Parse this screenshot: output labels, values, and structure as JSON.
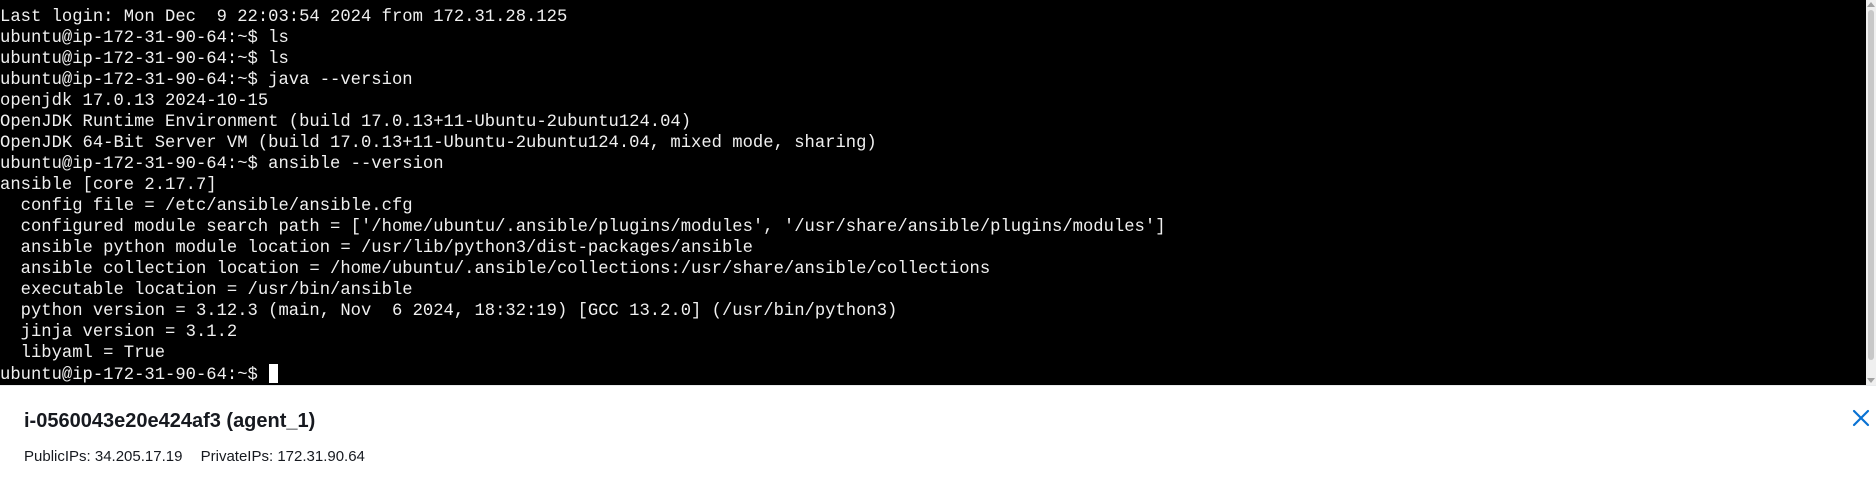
{
  "terminal": {
    "lines": [
      "Last login: Mon Dec  9 22:03:54 2024 from 172.31.28.125",
      "ubuntu@ip-172-31-90-64:~$ ls",
      "ubuntu@ip-172-31-90-64:~$ ls",
      "ubuntu@ip-172-31-90-64:~$ java --version",
      "openjdk 17.0.13 2024-10-15",
      "OpenJDK Runtime Environment (build 17.0.13+11-Ubuntu-2ubuntu124.04)",
      "OpenJDK 64-Bit Server VM (build 17.0.13+11-Ubuntu-2ubuntu124.04, mixed mode, sharing)",
      "ubuntu@ip-172-31-90-64:~$ ansible --version",
      "ansible [core 2.17.7]",
      "  config file = /etc/ansible/ansible.cfg",
      "  configured module search path = ['/home/ubuntu/.ansible/plugins/modules', '/usr/share/ansible/plugins/modules']",
      "  ansible python module location = /usr/lib/python3/dist-packages/ansible",
      "  ansible collection location = /home/ubuntu/.ansible/collections:/usr/share/ansible/collections",
      "  executable location = /usr/bin/ansible",
      "  python version = 3.12.3 (main, Nov  6 2024, 18:32:19) [GCC 13.2.0] (/usr/bin/python3)",
      "  jinja version = 3.1.2",
      "  libyaml = True"
    ],
    "prompt": "ubuntu@ip-172-31-90-64:~$ "
  },
  "instance": {
    "title": "i-0560043e20e424af3 (agent_1)",
    "public_ips": "PublicIPs: 34.205.17.19",
    "private_ips": "PrivateIPs: 172.31.90.64"
  },
  "icons": {
    "close": "close-icon"
  },
  "colors": {
    "terminal_bg": "#000000",
    "terminal_fg": "#f0f0f0",
    "accent": "#0972d3",
    "text": "#16191f"
  }
}
